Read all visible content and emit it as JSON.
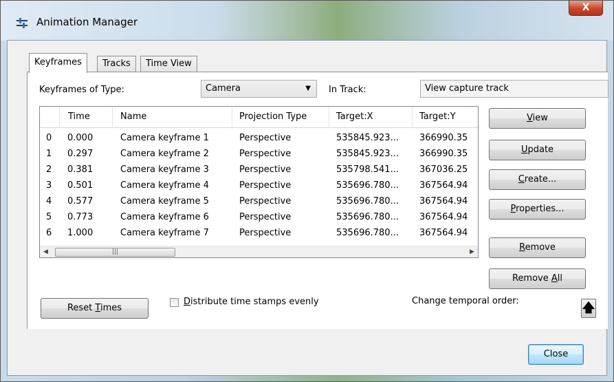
{
  "window": {
    "title": "Animation Manager",
    "close_glyph": "X"
  },
  "tabs": [
    {
      "label": "Keyframes",
      "active": true
    },
    {
      "label": "Tracks",
      "active": false
    },
    {
      "label": "Time View",
      "active": false
    }
  ],
  "filter": {
    "type_label": "Keyframes of Type:",
    "type_value": "Camera",
    "track_label": "In Track:",
    "track_value": "View capture track"
  },
  "table": {
    "columns": [
      "",
      "Time",
      "Name",
      "Projection Type",
      "Target:X",
      "Target:Y"
    ],
    "rows": [
      {
        "index": "0",
        "time": "0.000",
        "name": "Camera keyframe 1",
        "projection": "Perspective",
        "target_x": "535845.923...",
        "target_y": "366990.35"
      },
      {
        "index": "1",
        "time": "0.297",
        "name": "Camera keyframe 2",
        "projection": "Perspective",
        "target_x": "535845.923...",
        "target_y": "366990.35"
      },
      {
        "index": "2",
        "time": "0.381",
        "name": "Camera keyframe 3",
        "projection": "Perspective",
        "target_x": "535798.541...",
        "target_y": "367036.25"
      },
      {
        "index": "3",
        "time": "0.501",
        "name": "Camera keyframe 4",
        "projection": "Perspective",
        "target_x": "535696.780...",
        "target_y": "367564.94"
      },
      {
        "index": "4",
        "time": "0.577",
        "name": "Camera keyframe 5",
        "projection": "Perspective",
        "target_x": "535696.780...",
        "target_y": "367564.94"
      },
      {
        "index": "5",
        "time": "0.773",
        "name": "Camera keyframe 6",
        "projection": "Perspective",
        "target_x": "535696.780...",
        "target_y": "367564.94"
      },
      {
        "index": "6",
        "time": "1.000",
        "name": "Camera keyframe 7",
        "projection": "Perspective",
        "target_x": "535696.780...",
        "target_y": "367564.94"
      }
    ]
  },
  "side_buttons": {
    "view": {
      "pre": "",
      "key": "V",
      "post": "iew"
    },
    "update": {
      "pre": "",
      "key": "U",
      "post": "pdate"
    },
    "create": {
      "pre": "",
      "key": "C",
      "post": "reate..."
    },
    "properties": {
      "pre": "",
      "key": "P",
      "post": "roperties..."
    },
    "remove": {
      "pre": "",
      "key": "R",
      "post": "emove"
    },
    "remove_all": {
      "pre": "Remove ",
      "key": "A",
      "post": "ll"
    }
  },
  "bottom": {
    "reset_times": {
      "pre": "Reset ",
      "key": "T",
      "post": "imes"
    },
    "distribute": {
      "pre": "",
      "key": "D",
      "post": "istribute time stamps evenly",
      "checked": false
    },
    "temporal_label": "Change temporal order:",
    "up_arrow_glyph": "🡅"
  },
  "footer": {
    "close_label": "Close"
  }
}
